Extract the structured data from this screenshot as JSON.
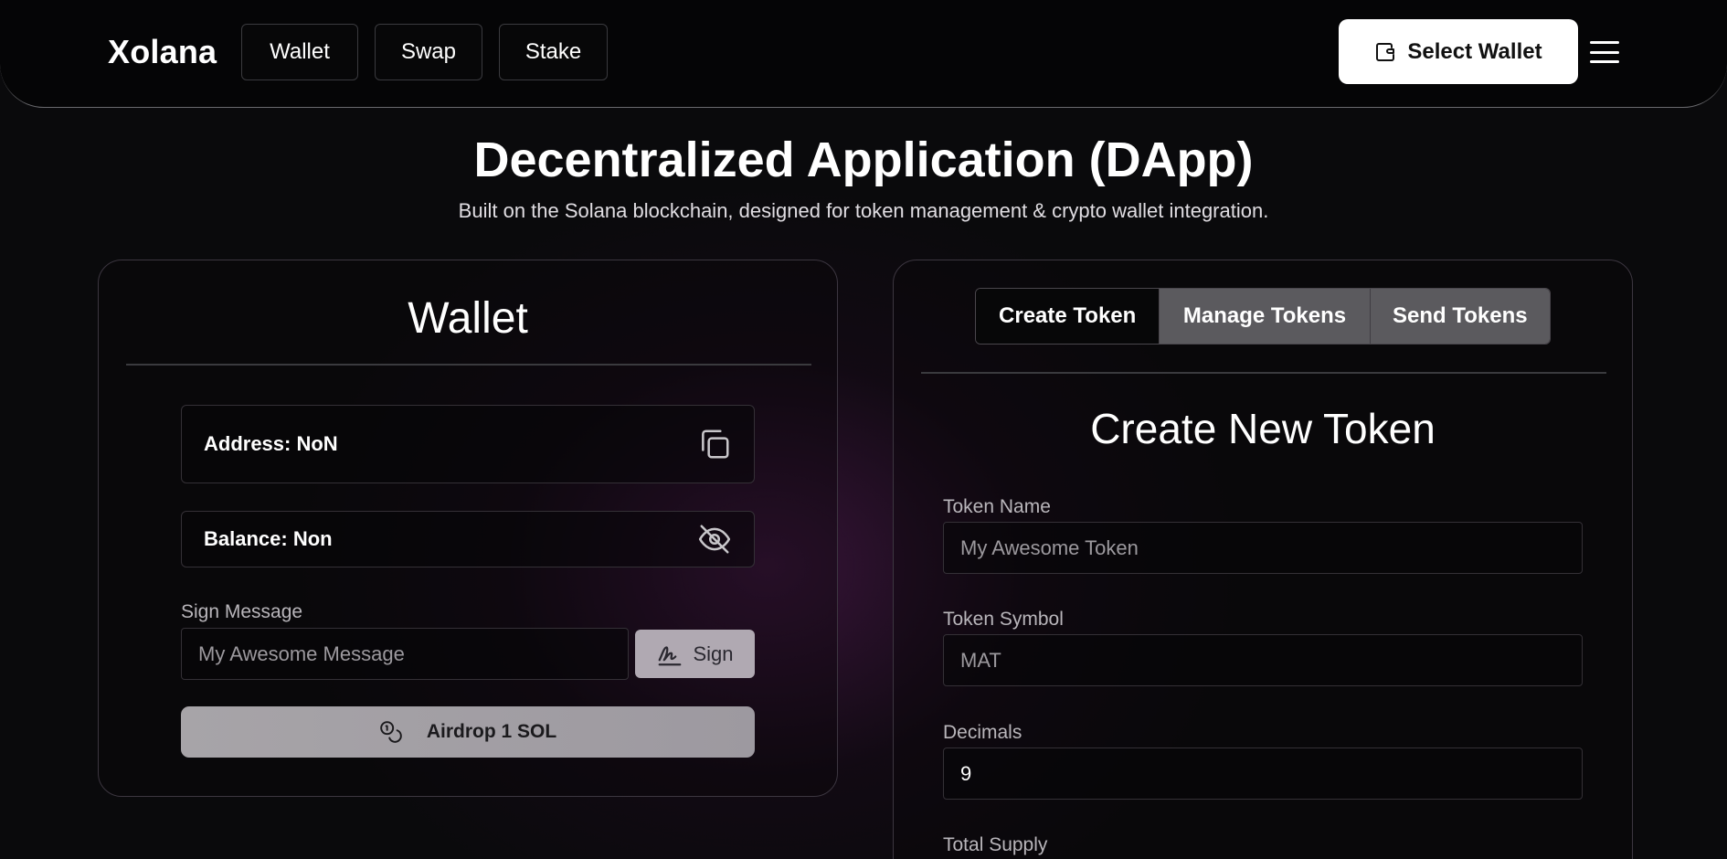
{
  "header": {
    "brand": "Xolana",
    "nav": [
      "Wallet",
      "Swap",
      "Stake"
    ],
    "select_wallet_label": "Select Wallet"
  },
  "hero": {
    "title": "Decentralized Application (DApp)",
    "subtitle": "Built on the Solana blockchain, designed for token management & crypto wallet integration."
  },
  "wallet": {
    "title": "Wallet",
    "address": "Address: NoN",
    "balance": "Balance: Non",
    "sign_label": "Sign Message",
    "sign_placeholder": "My Awesome Message",
    "sign_button": "Sign",
    "airdrop_button": "Airdrop 1 SOL",
    "icons": [
      "copy-icon",
      "eye-off-icon",
      "signature-icon",
      "coins-icon"
    ]
  },
  "tokens": {
    "tabs": [
      "Create Token",
      "Manage Tokens",
      "Send Tokens"
    ],
    "active_tab": "Create Token",
    "form_title": "Create New Token",
    "fields": {
      "name_label": "Token Name",
      "name_placeholder": "My Awesome Token",
      "symbol_label": "Token Symbol",
      "symbol_placeholder": "MAT",
      "decimals_label": "Decimals",
      "decimals_value": "9",
      "supply_label": "Total Supply"
    }
  },
  "colors": {
    "background": "#0a0a0c",
    "accent_glow": "#5c1c5c",
    "primary_button": "#ffffff",
    "tab_inactive": "#5b5a5e"
  }
}
